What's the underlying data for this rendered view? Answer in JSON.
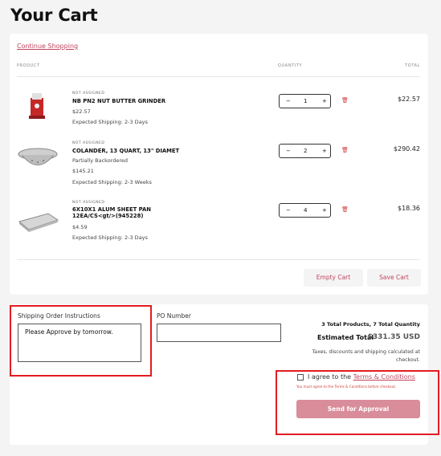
{
  "page": {
    "title": "Your Cart"
  },
  "cart": {
    "continue_label": "Continue Shopping",
    "headers": {
      "product": "PRODUCT",
      "quantity": "QUANTITY",
      "total": "TOTAL"
    },
    "items": [
      {
        "status": "NOT ASSIGNED",
        "name": "NB PN2 NUT BUTTER GRINDER",
        "price": "$22.57",
        "backorder": "",
        "shipping": "Expected Shipping: 2-3 Days",
        "qty": "1",
        "total": "$22.57",
        "image": "red-grinder"
      },
      {
        "status": "NOT ASSIGNED",
        "name": "COLANDER, 13 QUART, 13\" DIAMET",
        "backorder": "Partially Backordered",
        "price": "$145.21",
        "shipping": "Expected Shipping: 2-3 Weeks",
        "qty": "2",
        "total": "$290.42",
        "image": "colander"
      },
      {
        "status": "NOT ASSIGNED",
        "name": "6X10X1 ALUM SHEET PAN 12EA/CS<gt/>(945228)",
        "price": "$4.59",
        "backorder": "",
        "shipping": "Expected Shipping: 2-3 Days",
        "qty": "4",
        "total": "$18.36",
        "image": "sheet-pan"
      }
    ],
    "minus": "−",
    "plus": "+",
    "trash_icon": "trash-icon",
    "empty_label": "Empty Cart",
    "save_label": "Save Cart"
  },
  "checkout": {
    "instructions_label": "Shipping Order Instructions",
    "instructions_value": "Please Approve by tomorrow.",
    "po_label": "PO Number",
    "po_value": "",
    "totals_summary": "3 Total Products, 7 Total Quantity",
    "estimated_label": "Estimated Total",
    "estimated_value": "$331.35 USD",
    "taxes_note": "Taxes, discounts and shipping calculated at checkout.",
    "agree_prefix": "I agree to the",
    "terms_link": "Terms & Conditions",
    "must_agree": "You must agree to the Terms & Conditions before checkout.",
    "approve_label": "Send for Approval"
  },
  "colors": {
    "accent": "#c0455e",
    "button_disabled": "#d98c9a",
    "highlight": "#e31b23"
  }
}
